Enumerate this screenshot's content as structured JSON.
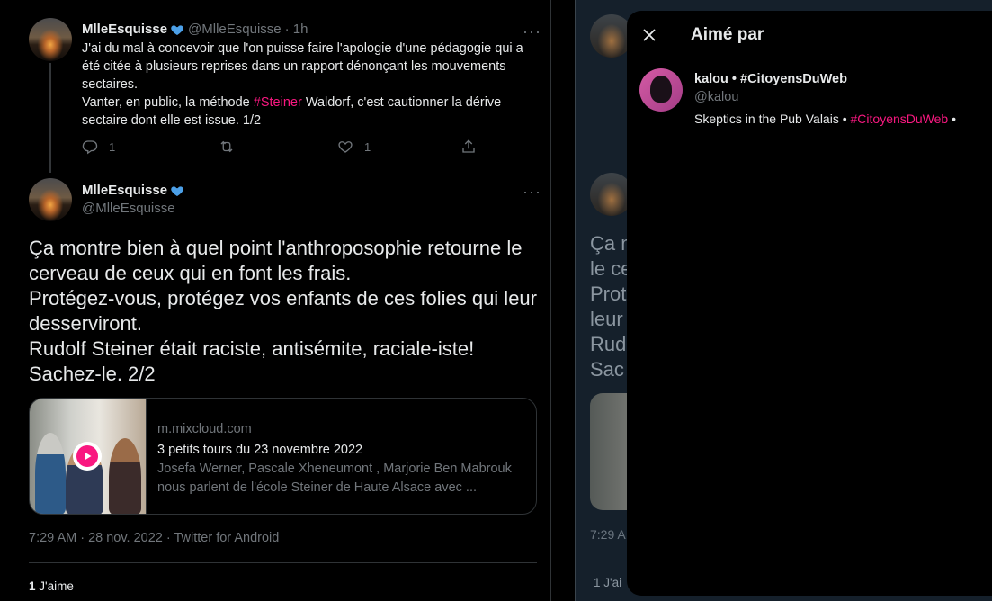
{
  "reply_tweet": {
    "author_name": "MlleEsquisse",
    "author_handle": "@MlleEsquisse",
    "time_ago": "· 1h",
    "text_part1": "J'ai du mal à concevoir que l'on puisse faire l'apologie d'une pédagogie qui a été citée à plusieurs reprises dans un rapport dénonçant les mouvements sectaires.",
    "text_part2_pre": "Vanter, en public, la méthode ",
    "text_hashtag": "#Steiner",
    "text_part2_post": " Waldorf, c'est cautionner la dérive sectaire dont elle est issue. 1/2",
    "reply_count": "1",
    "like_count": "1",
    "icons": [
      "reply-icon",
      "retweet-icon",
      "like-icon",
      "share-icon"
    ]
  },
  "main_tweet": {
    "author_name": "MlleEsquisse",
    "author_handle": "@MlleEsquisse",
    "text": "Ça montre bien à quel point l'anthroposophie retourne le cerveau de ceux qui en font les frais.\nProtégez-vous, protégez vos enfants de ces folies qui leur desserviront.\nRudolf Steiner était raciste, antisémite, raciale-iste!\nSachez-le. 2/2",
    "card": {
      "domain": "m.mixcloud.com",
      "title": "3 petits tours du 23 novembre 2022",
      "description": "Josefa Werner, Pascale Xheneumont , Marjorie Ben Mabrouk nous parlent de l'école Steiner de Haute Alsace avec ..."
    },
    "timestamp": "7:29 AM · 28 nov. 2022 · Twitter for Android",
    "likes_count": "1",
    "likes_label": "J'aime"
  },
  "background_column": {
    "text": "Ça m\nle ce\nProt\nleur\nRud\nSac",
    "timestamp": "7:29 A",
    "likes": "1 J'ai"
  },
  "likes_modal": {
    "title": "Aimé par",
    "users": [
      {
        "name": "kalou • #CitoyensDuWeb",
        "handle": "@kalou",
        "bio_pre": "Skeptics in the Pub Valais • ",
        "bio_hashtag": "#CitoyensDuWeb",
        "bio_post": " •"
      }
    ]
  },
  "colors": {
    "background": "#000000",
    "hashtag": "#f91880",
    "verified": "#4ca0e8",
    "muted": "#71767b"
  }
}
